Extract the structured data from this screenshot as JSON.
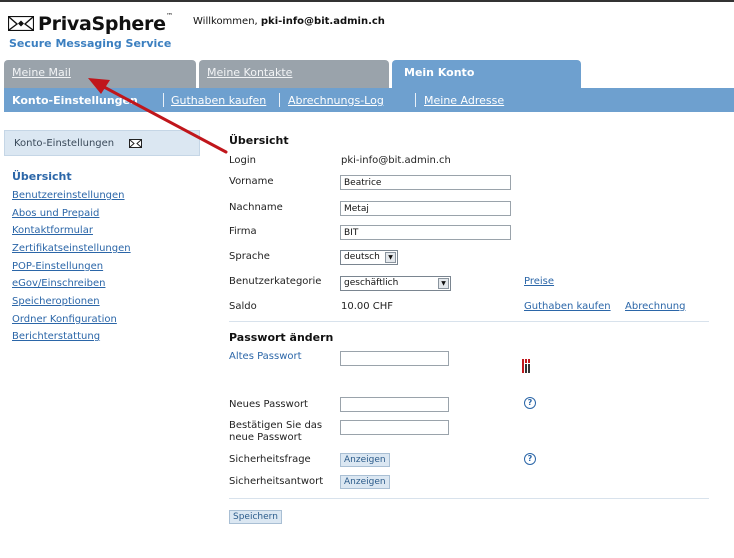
{
  "header": {
    "logo_name": "PrivaSphere",
    "logo_tm": "™",
    "logo_tagline": "Secure Messaging Service",
    "welcome_prefix": "Willkommen, ",
    "welcome_user": "pki-info@bit.admin.ch"
  },
  "tabs": [
    {
      "label": "Meine Mail"
    },
    {
      "label": "Meine Kontakte"
    },
    {
      "label": "Mein Konto"
    }
  ],
  "subnav": [
    {
      "label": "Konto-Einstellungen"
    },
    {
      "label": "Guthaben kaufen"
    },
    {
      "label": "Abrechnungs-Log"
    },
    {
      "label": "Meine Adresse"
    }
  ],
  "sidebar": {
    "title": "Konto-Einstellungen",
    "items": [
      {
        "label": "Übersicht"
      },
      {
        "label": "Benutzereinstellungen"
      },
      {
        "label": "Abos und Prepaid"
      },
      {
        "label": "Kontaktformular"
      },
      {
        "label": "Zertifikatseinstellungen"
      },
      {
        "label": "POP-Einstellungen"
      },
      {
        "label": "eGov/Einschreiben"
      },
      {
        "label": "Speicheroptionen"
      },
      {
        "label": "Ordner Konfiguration"
      },
      {
        "label": "Berichterstattung"
      }
    ]
  },
  "overview": {
    "title": "Übersicht",
    "login_label": "Login",
    "login_value": "pki-info@bit.admin.ch",
    "vorname_label": "Vorname",
    "vorname_value": "Beatrice",
    "nachname_label": "Nachname",
    "nachname_value": "Metaj",
    "firma_label": "Firma",
    "firma_value": "BIT",
    "sprache_label": "Sprache",
    "sprache_value": "deutsch",
    "kategorie_label": "Benutzerkategorie",
    "kategorie_value": "geschäftlich",
    "preise_link": "Preise",
    "saldo_label": "Saldo",
    "saldo_value": "10.00 CHF",
    "guthaben_link": "Guthaben kaufen",
    "abrechnung_link": "Abrechnung"
  },
  "password": {
    "title": "Passwort ändern",
    "altes_label": "Altes Passwort",
    "neues_label": "Neues Passwort",
    "bestaetigen_label_1": "Bestätigen Sie das",
    "bestaetigen_label_2": "neue Passwort",
    "frage_label": "Sicherheitsfrage",
    "antwort_label": "Sicherheitsantwort",
    "anzeigen": "Anzeigen",
    "help": "?",
    "save": "Speichern"
  },
  "colors": {
    "accent": "#6ea0cf",
    "tab_inactive": "#9aa3ab",
    "link": "#2b66a8",
    "annotation_arrow": "#c0161b"
  }
}
